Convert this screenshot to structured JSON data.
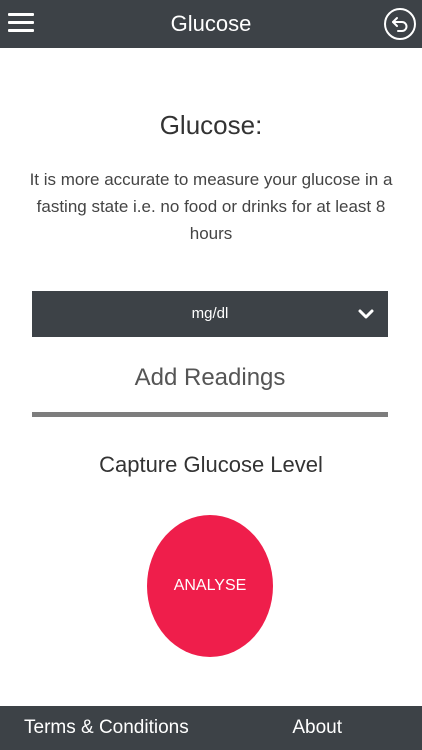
{
  "header": {
    "title": "Glucose",
    "menu_icon": "hamburger-menu-icon",
    "back_icon": "back-arrow-circle-icon"
  },
  "main": {
    "heading": "Glucose:",
    "info": "It is more accurate to measure your glucose in a fasting state i.e. no food or drinks for at least 8 hours",
    "unit_select": {
      "value": "mg/dl",
      "icon": "chevron-down-icon"
    },
    "add_readings_label": "Add Readings",
    "capture_label": "Capture Glucose Level",
    "analyse_label": "ANALYSE"
  },
  "footer": {
    "terms_label": "Terms & Conditions",
    "about_label": "About"
  },
  "colors": {
    "bar": "#3d4247",
    "accent": "#ef1e4b",
    "divider": "#7d7d7d"
  }
}
